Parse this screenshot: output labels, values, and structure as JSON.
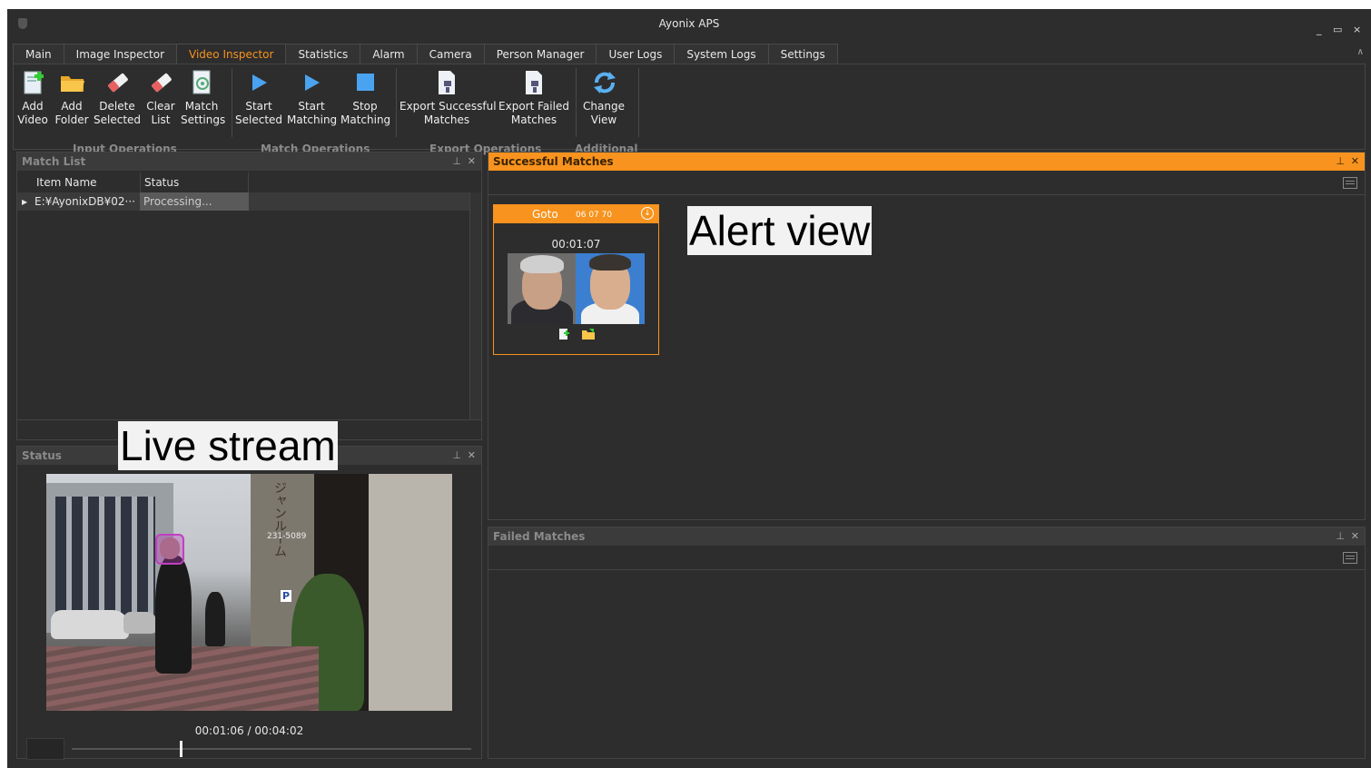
{
  "app": {
    "title": "Ayonix APS"
  },
  "window_controls": [
    "_",
    "▭",
    "×"
  ],
  "tabs": [
    {
      "label": "Main",
      "active": false
    },
    {
      "label": "Image Inspector",
      "active": false
    },
    {
      "label": "Video Inspector",
      "active": true
    },
    {
      "label": "Statistics",
      "active": false
    },
    {
      "label": "Alarm",
      "active": false
    },
    {
      "label": "Camera",
      "active": false
    },
    {
      "label": "Person Manager",
      "active": false
    },
    {
      "label": "User Logs",
      "active": false
    },
    {
      "label": "System Logs",
      "active": false
    },
    {
      "label": "Settings",
      "active": false
    }
  ],
  "ribbon": {
    "buttons": [
      {
        "line1": "Add",
        "line2": "Video",
        "icon": "add-video-icon"
      },
      {
        "line1": "Add",
        "line2": "Folder",
        "icon": "folder-icon"
      },
      {
        "line1": "Delete",
        "line2": "Selected",
        "icon": "eraser-icon"
      },
      {
        "line1": "Clear",
        "line2": "List",
        "icon": "eraser-icon"
      },
      {
        "line1": "Match",
        "line2": "Settings",
        "icon": "settings-document-icon"
      },
      {
        "line1": "Start",
        "line2": "Selected",
        "icon": "play-icon"
      },
      {
        "line1": "Start",
        "line2": "Matching",
        "icon": "play-icon"
      },
      {
        "line1": "Stop",
        "line2": "Matching",
        "icon": "stop-icon"
      },
      {
        "line1": "Export Successful",
        "line2": "Matches",
        "icon": "export-document-icon"
      },
      {
        "line1": "Export Failed",
        "line2": "Matches",
        "icon": "export-document-icon"
      },
      {
        "line1": "Change",
        "line2": "View",
        "icon": "refresh-icon"
      }
    ],
    "groups": [
      "Input Operations",
      "Match Operations",
      "Export Operations",
      "Additional"
    ]
  },
  "match_list": {
    "title": "Match List",
    "columns": [
      "Item Name",
      "Status"
    ],
    "rows": [
      {
        "item_name": "E:¥AyonixDB¥02···",
        "status": "Processing..."
      }
    ]
  },
  "status_panel": {
    "title": "Status",
    "time_display": "00:01:06 / 00:04:02",
    "progress": 0.27,
    "scene_sign_text": "231-5089",
    "scene_vertical_text": "ジャンルーム",
    "scene_parking": "P"
  },
  "successful_matches": {
    "title": "Successful Matches",
    "card": {
      "name": "Goto",
      "id": "06 07 70",
      "timestamp": "00:01:07"
    }
  },
  "failed_matches": {
    "title": "Failed Matches"
  },
  "annotations": {
    "alert_view": "Alert view",
    "live_stream": "Live stream"
  },
  "colors": {
    "accent": "#f7931e",
    "background": "#2d2d2d",
    "face_box": "#c040c0"
  }
}
